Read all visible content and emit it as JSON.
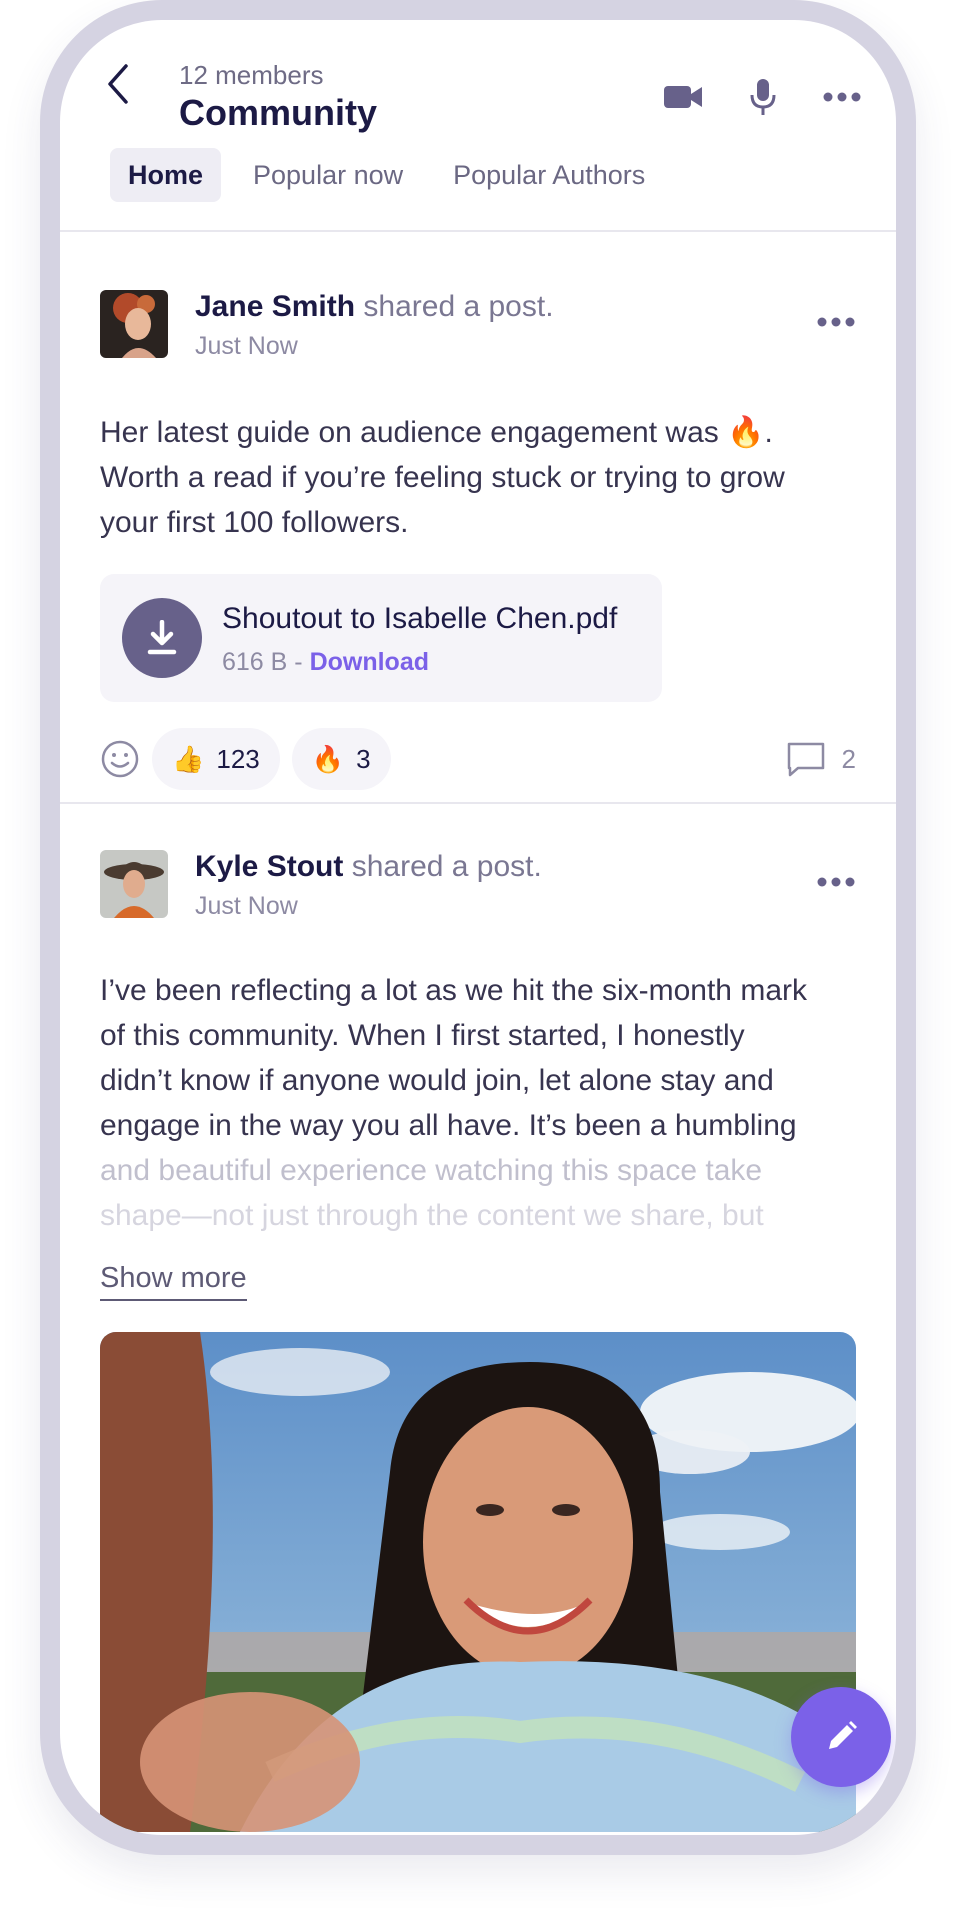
{
  "header": {
    "members": "12 members",
    "title": "Community"
  },
  "tabs": [
    {
      "label": "Home",
      "active": true
    },
    {
      "label": "Popular now",
      "active": false
    },
    {
      "label": "Popular Authors",
      "active": false
    }
  ],
  "posts": [
    {
      "author": "Jane Smith",
      "action": "shared a post.",
      "time": "Just Now",
      "body": [
        "Her latest guide on audience engagement was 🔥.",
        "Worth a read if you’re feeling stuck or trying to grow",
        "your first 100 followers."
      ],
      "attachment": {
        "filename": "Shoutout to Isabelle Chen.pdf",
        "size": "616 B -",
        "download_label": "Download"
      },
      "reactions": [
        {
          "emoji": "👍",
          "count": "123"
        },
        {
          "emoji": "🔥",
          "count": "3"
        }
      ],
      "comments": "2"
    },
    {
      "author": "Kyle Stout",
      "action": "shared a post.",
      "time": "Just Now",
      "body": [
        "I’ve been reflecting a lot as we hit the six-month mark",
        "of this community. When I first started, I honestly",
        "didn’t know if anyone would join, let alone stay and",
        "engage in the way you all have. It’s been a humbling",
        "and beautiful experience watching this space take",
        "shape—not just through the content we share, but"
      ],
      "show_more": "Show more"
    }
  ],
  "colors": {
    "accent": "#7b61e8",
    "title": "#1c1a45",
    "frame": "#d5d3e2"
  },
  "icons": [
    "back-arrow-icon",
    "video-camera-icon",
    "microphone-icon",
    "more-options-icon",
    "download-icon",
    "smiley-icon",
    "comment-icon",
    "pencil-icon"
  ]
}
